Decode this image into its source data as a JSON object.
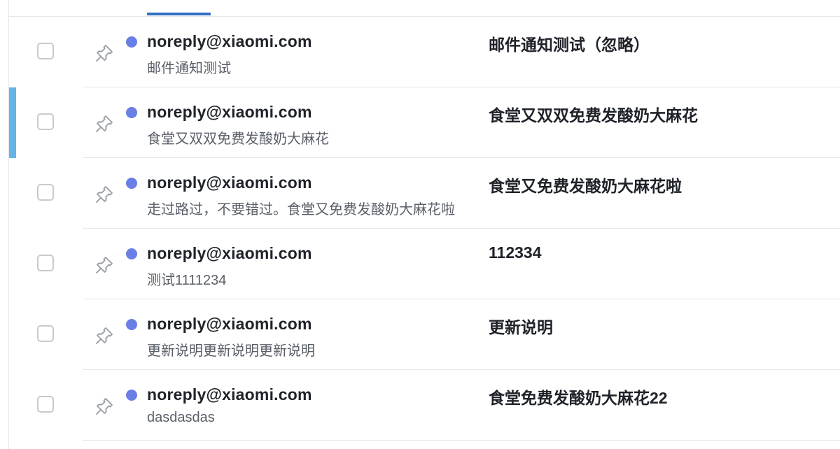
{
  "colors": {
    "unread_dot": "#6a7fe6",
    "selected_accent": "#66b3e6",
    "tab_indicator": "#2f6fc1"
  },
  "mails": [
    {
      "sender": "noreply@xiaomi.com",
      "preview": "邮件通知测试",
      "subject": "邮件通知测试（忽略）",
      "selected": false
    },
    {
      "sender": "noreply@xiaomi.com",
      "preview": "食堂又双双免费发酸奶大麻花",
      "subject": "食堂又双双免费发酸奶大麻花",
      "selected": true
    },
    {
      "sender": "noreply@xiaomi.com",
      "preview": "走过路过，不要错过。食堂又免费发酸奶大麻花啦",
      "subject": "食堂又免费发酸奶大麻花啦",
      "selected": false
    },
    {
      "sender": "noreply@xiaomi.com",
      "preview": "测试1111234",
      "subject": "112334",
      "selected": false
    },
    {
      "sender": "noreply@xiaomi.com",
      "preview": "更新说明更新说明更新说明",
      "subject": "更新说明",
      "selected": false
    },
    {
      "sender": "noreply@xiaomi.com",
      "preview": "dasdasdas",
      "subject": "食堂免费发酸奶大麻花22",
      "selected": false
    }
  ]
}
